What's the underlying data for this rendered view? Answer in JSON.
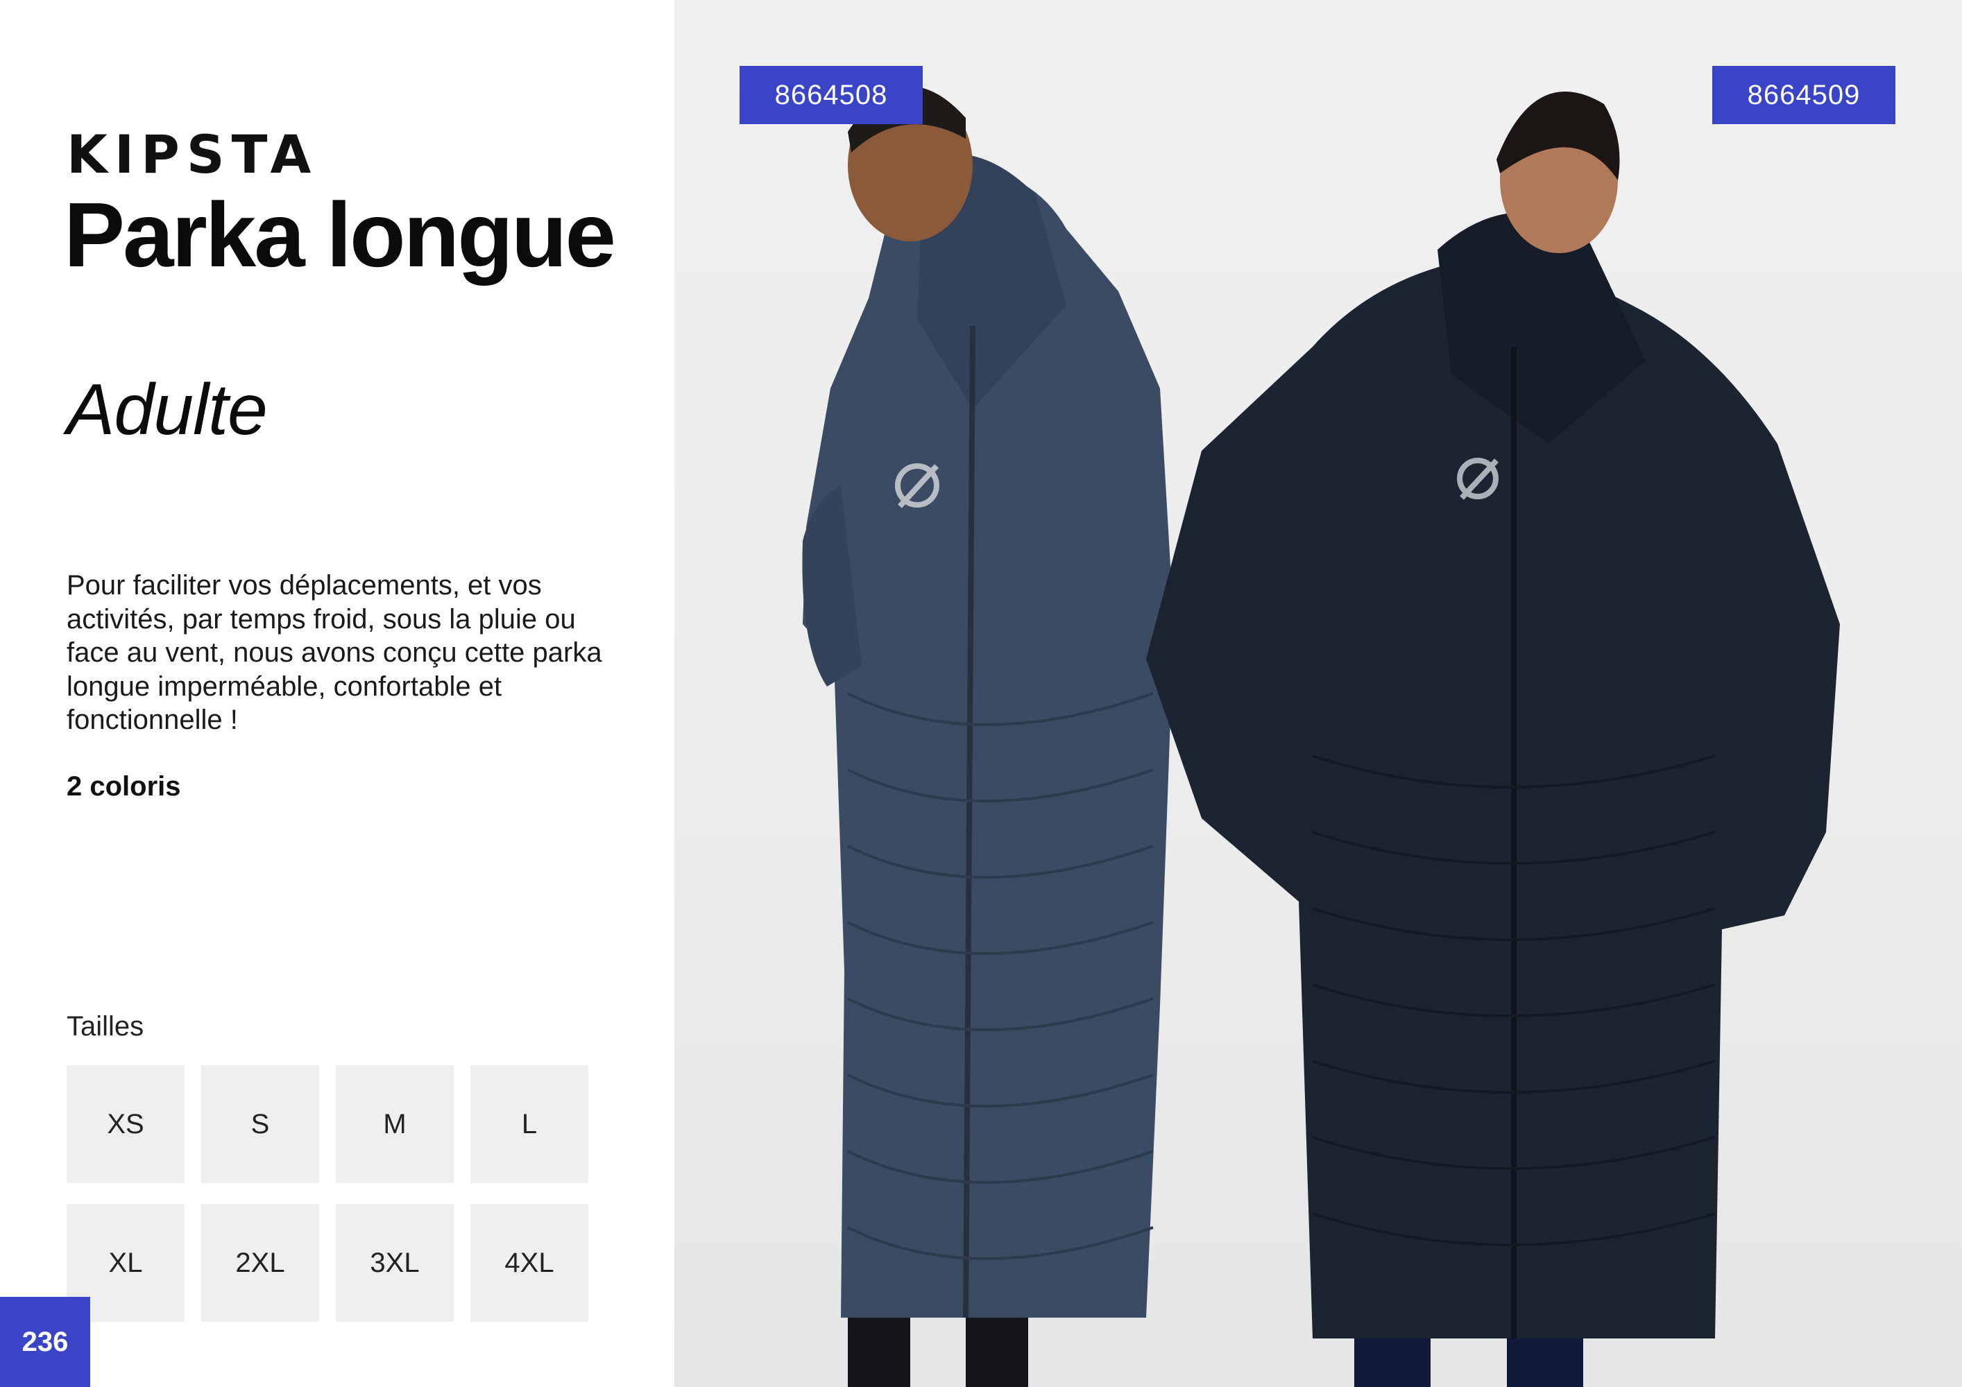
{
  "brand": "KIPSTA",
  "title": "Parka longue",
  "subtitle": "Adulte",
  "description": "Pour faciliter vos déplacements, et vos activités, par temps froid, sous la pluie ou face au vent, nous avons conçu cette parka longue imperméable, confortable et fonctionnelle !",
  "colors_count": "2 coloris",
  "sizes": {
    "label": "Tailles",
    "items": [
      "XS",
      "S",
      "M",
      "L",
      "XL",
      "2XL",
      "3XL",
      "4XL"
    ]
  },
  "page_number": "236",
  "products": [
    {
      "reference": "8664508",
      "color": "#3b4b63"
    },
    {
      "reference": "8664509",
      "color": "#1c2431"
    }
  ],
  "theme": {
    "accent": "#3a44c6",
    "size_box": "#efefef",
    "background_photo": "#ececec"
  }
}
